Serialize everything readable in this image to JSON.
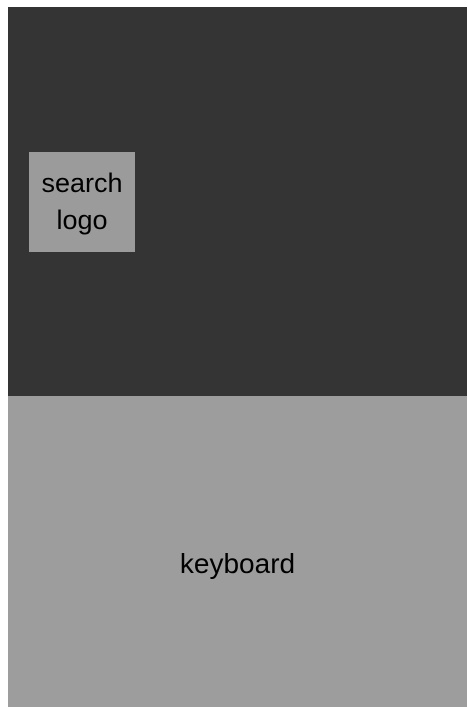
{
  "search_logo": {
    "label": "search\nlogo"
  },
  "keyboard": {
    "label": "keyboard"
  },
  "colors": {
    "top_background": "#343434",
    "logo_background": "#9b9b9b",
    "keyboard_background": "#9d9d9d",
    "text": "#000000"
  }
}
